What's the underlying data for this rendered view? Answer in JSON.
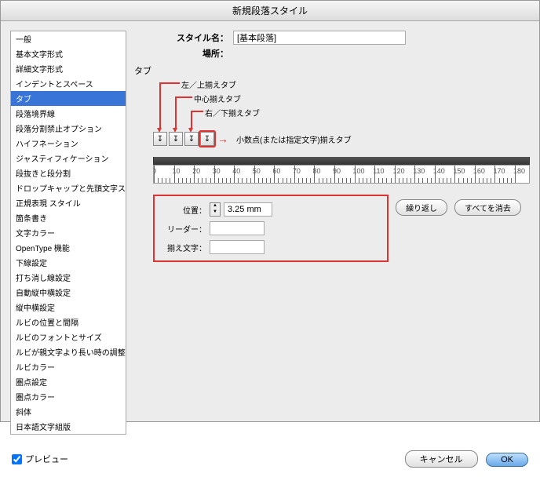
{
  "title": "新規段落スタイル",
  "styleName": {
    "label": "スタイル名：",
    "value": "[基本段落]"
  },
  "location": {
    "label": "場所：",
    "value": ""
  },
  "sectionHeader": "タブ",
  "sidebar": {
    "selectedIndex": 4,
    "items": [
      "一般",
      "基本文字形式",
      "詳細文字形式",
      "インデントとスペース",
      "タブ",
      "段落境界線",
      "段落分割禁止オプション",
      "ハイフネーション",
      "ジャスティフィケーション",
      "段抜きと段分割",
      "ドロップキャップと先頭文字スタイル",
      "正規表現 スタイル",
      "箇条書き",
      "文字カラー",
      "OpenType 機能",
      "下線設定",
      "打ち消し線設定",
      "自動縦中横設定",
      "縦中横設定",
      "ルビの位置と間隔",
      "ルビのフォントとサイズ",
      "ルビが親文字より長い時の調整",
      "ルビカラー",
      "圏点設定",
      "圏点カラー",
      "斜体",
      "日本語文字組版"
    ]
  },
  "annotations": {
    "left": "左／上揃えタブ",
    "center": "中心揃えタブ",
    "right": "右／下揃えタブ",
    "decimal": "小数点(または指定文字)揃えタブ"
  },
  "tabIcons": {
    "left": "↧",
    "center": "↧",
    "right": "↧",
    "decimal": "↧"
  },
  "ruler": {
    "start": 0,
    "end": 180,
    "step": 10
  },
  "controls": {
    "position": {
      "label": "位置：",
      "value": "3.25 mm"
    },
    "leader": {
      "label": "リーダー：",
      "value": ""
    },
    "alignChar": {
      "label": "揃え文字：",
      "value": ""
    },
    "repeat": "繰り返し",
    "clearAll": "すべてを消去"
  },
  "footer": {
    "preview": "プレビュー",
    "cancel": "キャンセル",
    "ok": "OK"
  }
}
